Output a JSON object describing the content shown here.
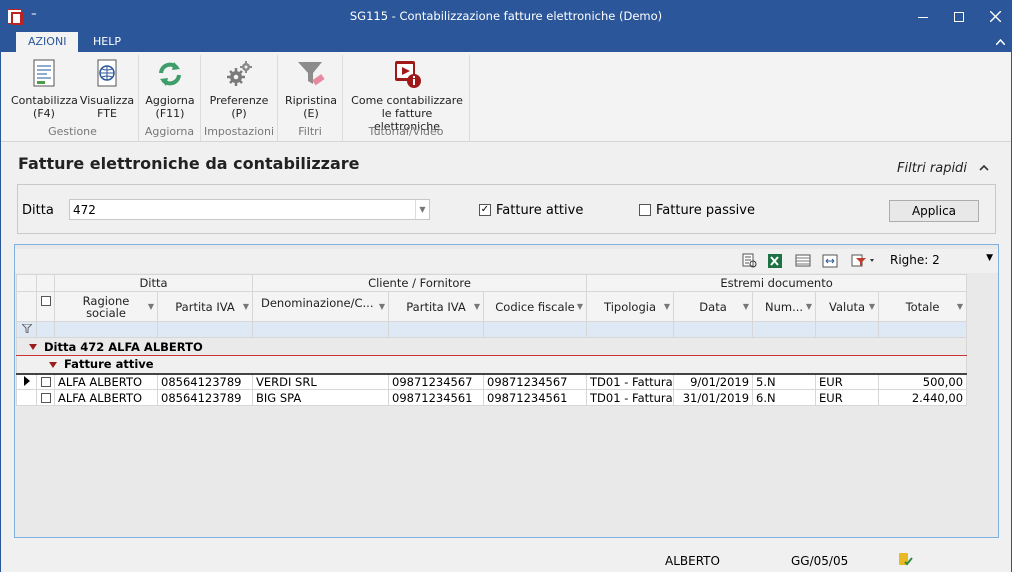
{
  "window": {
    "title": "SG115 - Contabilizzazione fatture elettroniche  (Demo)",
    "qat_symbol": "⁼"
  },
  "ribbon": {
    "tabs": [
      {
        "label": "AZIONI",
        "active": true
      },
      {
        "label": "HELP",
        "active": false
      }
    ],
    "groups": [
      {
        "label": "Gestione",
        "buttons": [
          {
            "label1": "Contabilizza",
            "label2": "(F4)",
            "icon": "document-lines-icon"
          },
          {
            "label1": "Visualizza",
            "label2": "FTE",
            "icon": "globe-document-icon"
          }
        ]
      },
      {
        "label": "Aggiorna",
        "buttons": [
          {
            "label1": "Aggiorna",
            "label2": "(F11)",
            "icon": "refresh-icon"
          }
        ]
      },
      {
        "label": "Impostazioni",
        "buttons": [
          {
            "label1": "Preferenze",
            "label2": "(P)",
            "icon": "gears-icon"
          }
        ]
      },
      {
        "label": "Filtri",
        "buttons": [
          {
            "label1": "Ripristina",
            "label2": "(E)",
            "icon": "funnel-eraser-icon"
          }
        ]
      },
      {
        "label": "Tutorial/Video",
        "buttons": [
          {
            "label1": "Come contabilizzare",
            "label2": "le fatture elettroniche",
            "icon": "video-info-icon"
          }
        ]
      }
    ]
  },
  "main": {
    "title": "Fatture elettroniche da contabilizzare",
    "filtri_rapidi": "Filtri rapidi"
  },
  "filters": {
    "ditta_label": "Ditta",
    "ditta_value": "472",
    "fatture_attive_label": "Fatture attive",
    "fatture_attive_checked": true,
    "fatture_passive_label": "Fatture passive",
    "fatture_passive_checked": false,
    "apply_label": "Applica"
  },
  "grid": {
    "righe_label": "Righe: 2",
    "bands": {
      "ditta": "Ditta",
      "cliente": "Cliente / Fornitore",
      "estremi": "Estremi documento"
    },
    "columns": {
      "ragione": "Ragione sociale",
      "piva_ditta": "Partita IVA",
      "denominazione": "Denominazione/C...",
      "piva_cf": "Partita IVA",
      "codice_fiscale": "Codice fiscale",
      "tipologia": "Tipologia",
      "data": "Data",
      "numero": "Num...",
      "valuta": "Valuta",
      "totale": "Totale"
    },
    "group1": "Ditta 472 ALFA ALBERTO",
    "group2": "Fatture attive",
    "rows": [
      {
        "ragione": "ALFA ALBERTO",
        "piva_ditta": "08564123789",
        "denominazione": "VERDI SRL",
        "piva_cf": "09871234567",
        "codice_fiscale": "09871234567",
        "tipologia": "TD01 - Fattura",
        "data": "9/01/2019",
        "numero": "5.N",
        "valuta": "EUR",
        "totale": "500,00"
      },
      {
        "ragione": "ALFA ALBERTO",
        "piva_ditta": "08564123789",
        "denominazione": "BIG SPA",
        "piva_cf": "09871234561",
        "codice_fiscale": "09871234561",
        "tipologia": "TD01 - Fattura",
        "data": "31/01/2019",
        "numero": "6.N",
        "valuta": "EUR",
        "totale": "2.440,00"
      }
    ]
  },
  "statusbar": {
    "user": "ALBERTO",
    "date": "GG/05/05"
  },
  "colors": {
    "titlebar": "#2b579a",
    "accent_red": "#9b1c1c"
  }
}
